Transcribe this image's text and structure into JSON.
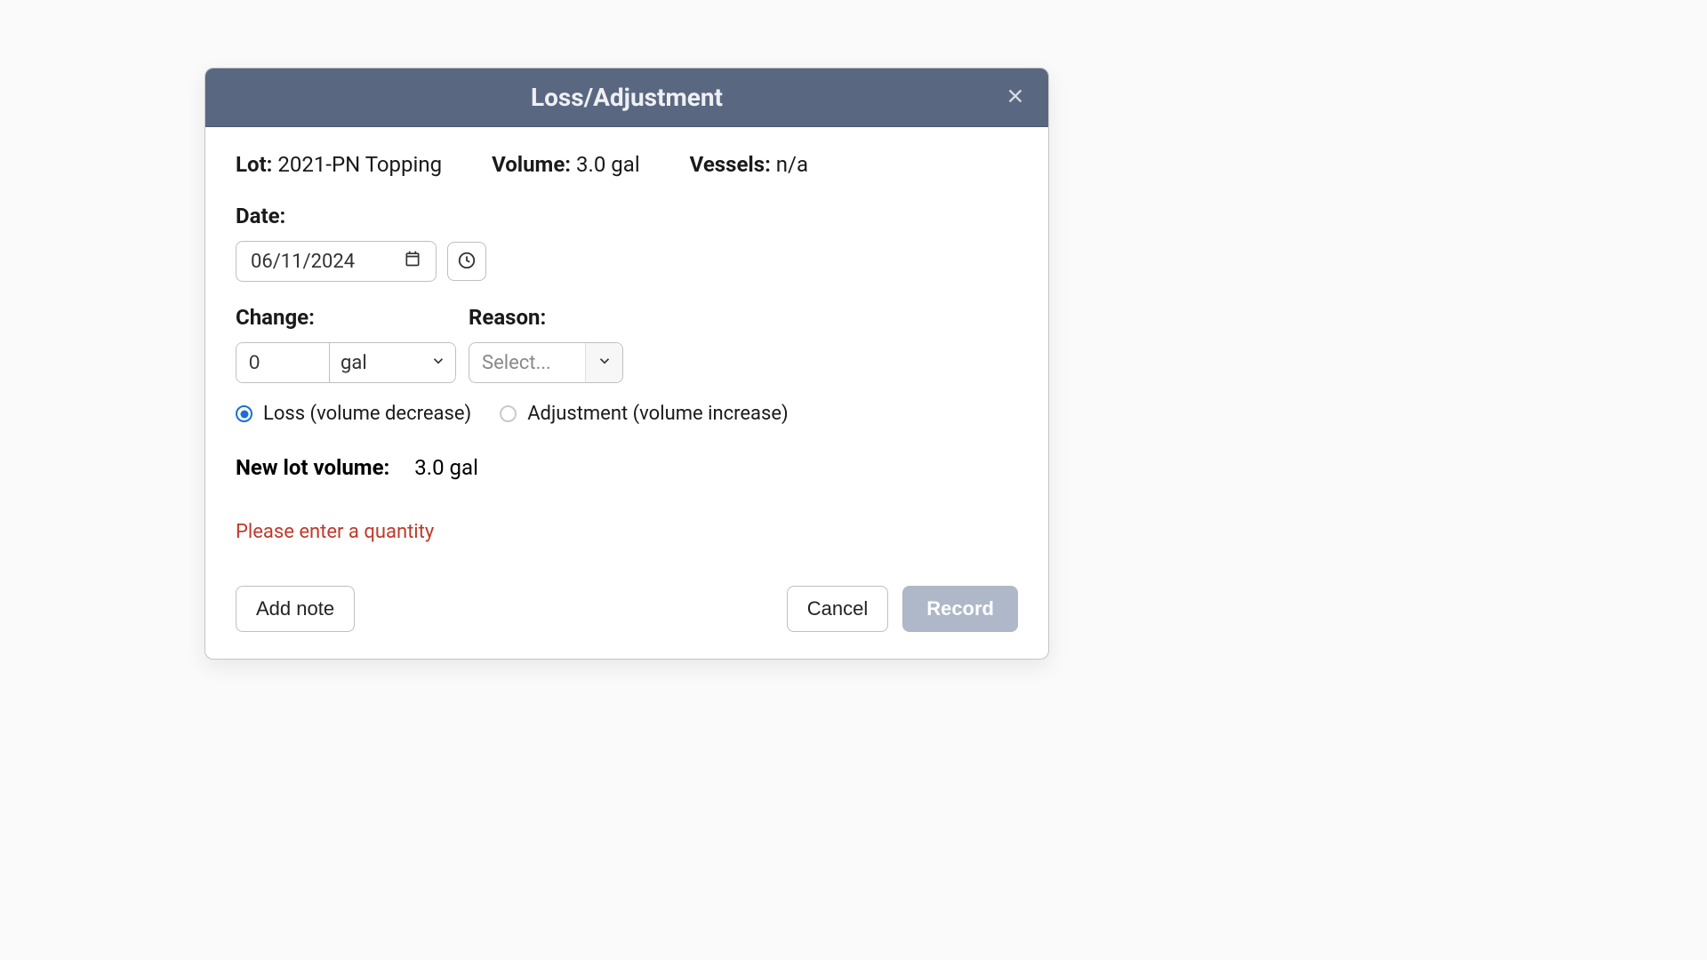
{
  "modal": {
    "title": "Loss/Adjustment"
  },
  "info": {
    "lot_label": "Lot:",
    "lot_value": "2021-PN Topping",
    "volume_label": "Volume:",
    "volume_value": "3.0 gal",
    "vessels_label": "Vessels:",
    "vessels_value": "n/a"
  },
  "date": {
    "label": "Date:",
    "value": "06/11/2024"
  },
  "change": {
    "label": "Change:",
    "value": "0",
    "unit": "gal"
  },
  "reason": {
    "label": "Reason:",
    "placeholder": "Select..."
  },
  "radio": {
    "loss_label": "Loss (volume decrease)",
    "adjustment_label": "Adjustment (volume increase)"
  },
  "new_volume": {
    "label": "New lot volume:",
    "value": "3.0 gal"
  },
  "error": "Please enter a quantity",
  "buttons": {
    "add_note": "Add note",
    "cancel": "Cancel",
    "record": "Record"
  }
}
